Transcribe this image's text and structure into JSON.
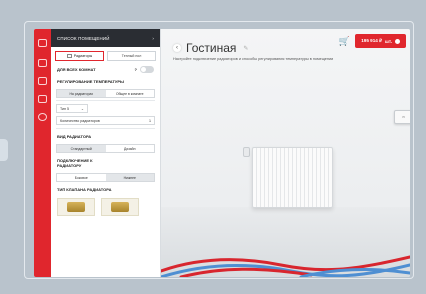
{
  "sidebar_panel": {
    "header_title": "Список помещений",
    "tabs": [
      "Радиаторы",
      "Теплый пол"
    ],
    "for_all_rooms_label": "Для всех комнат",
    "regulation_label": "Регулирование температуры",
    "regulation_options": [
      "На радиаторах",
      "Общее в комнате"
    ],
    "type_label": "Тип 5",
    "radiator_count_label": "Количество радиаторов",
    "radiator_count_value": "1",
    "radiator_view_label": "Вид радиатора",
    "view_options": [
      "Стандартный",
      "Дизайн"
    ],
    "connection_label": "Подключение к радиатору",
    "connection_options": [
      "Боковое",
      "Нижнее"
    ],
    "valve_type_label": "Тип клапана радиатора"
  },
  "main": {
    "room_title": "Гостиная",
    "subtitle": "Настройте подключение радиаторов и способы регулирования температуры в помещении",
    "price": "195 914 ₽",
    "price_suffix": "шт."
  },
  "colors": {
    "accent_red": "#e0262d",
    "dark_header": "#2a2d33",
    "pipe_red": "#d8262e",
    "pipe_blue": "#4f8fd2"
  },
  "icons": [
    "hamburger-icon",
    "calculator-icon",
    "document-icon",
    "list-icon",
    "info-icon",
    "cart-icon",
    "edit-icon",
    "back-icon",
    "close-icon"
  ]
}
